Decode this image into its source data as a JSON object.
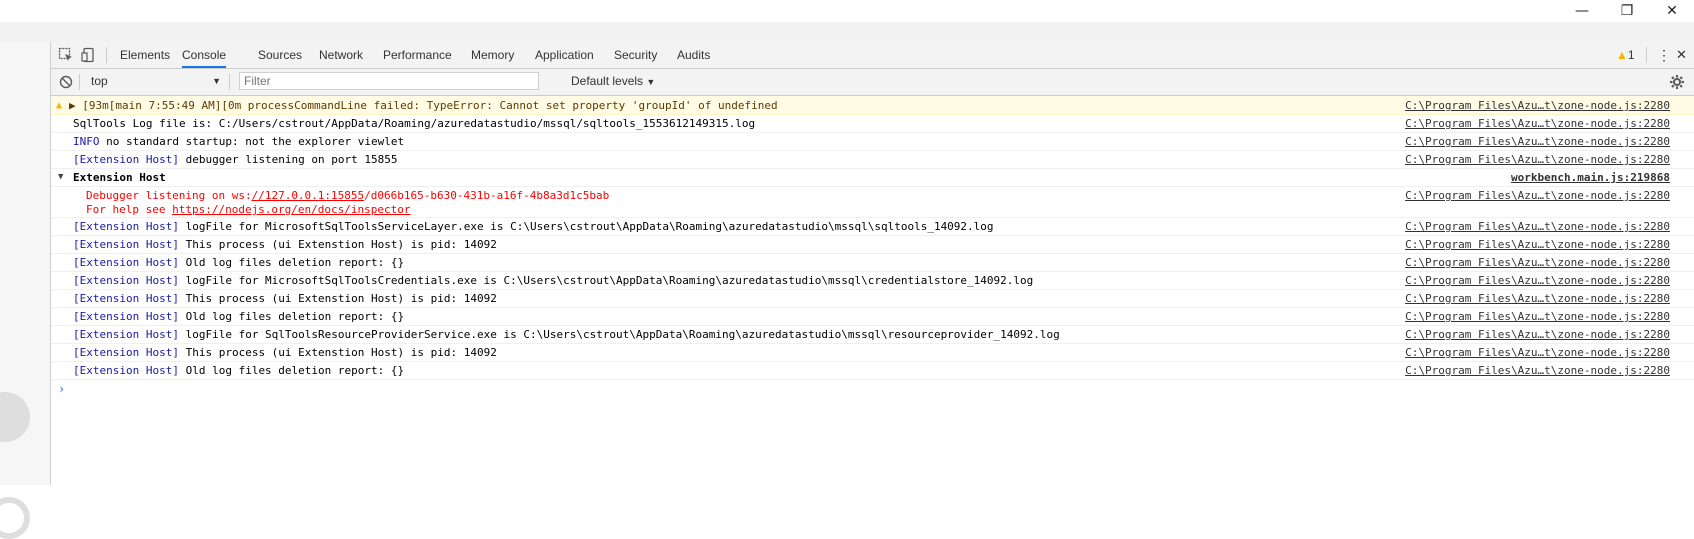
{
  "window": {
    "minimize_glyph": "—",
    "restore_glyph": "❐",
    "close_glyph": "✕"
  },
  "devtools": {
    "tabs": [
      "Elements",
      "Console",
      "Sources",
      "Network",
      "Performance",
      "Memory",
      "Application",
      "Security",
      "Audits"
    ],
    "active_tab": "Console",
    "warning_count": "1",
    "more_glyph": "⋮",
    "close_glyph": "✕"
  },
  "toolbar": {
    "context": "top",
    "filter_placeholder": "Filter",
    "levels": "Default levels"
  },
  "console": {
    "rows": [
      {
        "prefix": "",
        "text": "▶ \u001b[93m[main 7:55:49 AM]\u001b[0m processCommandLine failed: TypeError: Cannot set property 'groupId' of undefined",
        "source": "C:\\Program Files\\Azu…t\\zone-node.js:2280"
      },
      {
        "prefix": "",
        "text": "SqlTools Log file is: C:/Users/cstrout/AppData/Roaming/azuredatastudio/mssql/sqltools_1553612149315.log",
        "source": "C:\\Program Files\\Azu…t\\zone-node.js:2280"
      },
      {
        "prefix": " INFO",
        "text": " no standard startup: not the explorer viewlet",
        "source": "C:\\Program Files\\Azu…t\\zone-node.js:2280"
      },
      {
        "prefix": "[Extension Host]",
        "text": " debugger listening on port 15855",
        "source": "C:\\Program Files\\Azu…t\\zone-node.js:2280"
      },
      {
        "prefix": "",
        "text": "Extension Host",
        "source": "workbench.main.js:219868"
      },
      {
        "prefix": "",
        "text": "",
        "source": "C:\\Program Files\\Azu…t\\zone-node.js:2280"
      },
      {
        "prefix": "[Extension Host]",
        "text": " logFile for MicrosoftSqlToolsServiceLayer.exe is C:\\Users\\cstrout\\AppData\\Roaming\\azuredatastudio\\mssql\\sqltools_14092.log",
        "source": "C:\\Program Files\\Azu…t\\zone-node.js:2280"
      },
      {
        "prefix": "[Extension Host]",
        "text": " This process (ui Extenstion Host) is pid: 14092",
        "source": "C:\\Program Files\\Azu…t\\zone-node.js:2280"
      },
      {
        "prefix": "[Extension Host]",
        "text": " Old log files deletion report: {}",
        "source": "C:\\Program Files\\Azu…t\\zone-node.js:2280"
      },
      {
        "prefix": "[Extension Host]",
        "text": " logFile for MicrosoftSqlToolsCredentials.exe is C:\\Users\\cstrout\\AppData\\Roaming\\azuredatastudio\\mssql\\credentialstore_14092.log",
        "source": "C:\\Program Files\\Azu…t\\zone-node.js:2280"
      },
      {
        "prefix": "[Extension Host]",
        "text": " This process (ui Extenstion Host) is pid: 14092",
        "source": "C:\\Program Files\\Azu…t\\zone-node.js:2280"
      },
      {
        "prefix": "[Extension Host]",
        "text": " Old log files deletion report: {}",
        "source": "C:\\Program Files\\Azu…t\\zone-node.js:2280"
      },
      {
        "prefix": "[Extension Host]",
        "text": " logFile for SqlToolsResourceProviderService.exe is C:\\Users\\cstrout\\AppData\\Roaming\\azuredatastudio\\mssql\\resourceprovider_14092.log",
        "source": "C:\\Program Files\\Azu…t\\zone-node.js:2280"
      },
      {
        "prefix": "[Extension Host]",
        "text": " This process (ui Extenstion Host) is pid: 14092",
        "source": "C:\\Program Files\\Azu…t\\zone-node.js:2280"
      },
      {
        "prefix": "[Extension Host]",
        "text": " Old log files deletion report: {}",
        "source": "C:\\Program Files\\Azu…t\\zone-node.js:2280"
      }
    ],
    "debugger_line1_a": "Debugger listening on ws:",
    "debugger_line1_link": "//127.0.0.1:15855",
    "debugger_line1_b": "/d066b165-b630-431b-a16f-4b8a3d1c5bab",
    "debugger_line2_a": "For help see ",
    "debugger_line2_link": "https://nodejs.org/en/docs/inspector",
    "prompt": "›"
  },
  "colors": {
    "accent": "#1a73e8",
    "warning_bg": "#fffbe5",
    "error_red": "#ff0000",
    "prefix_blue": "#1a1aa6"
  },
  "icons": {
    "inspect": "inspect-icon",
    "device": "device-toggle-icon",
    "clear": "clear-console-icon",
    "settings": "gear-icon",
    "warning": "warning-icon"
  }
}
